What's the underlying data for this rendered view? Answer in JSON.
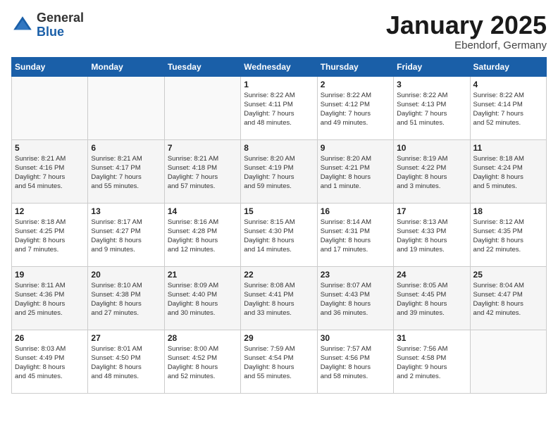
{
  "header": {
    "logo_general": "General",
    "logo_blue": "Blue",
    "month_title": "January 2025",
    "location": "Ebendorf, Germany"
  },
  "days_of_week": [
    "Sunday",
    "Monday",
    "Tuesday",
    "Wednesday",
    "Thursday",
    "Friday",
    "Saturday"
  ],
  "weeks": [
    [
      {
        "day": "",
        "info": ""
      },
      {
        "day": "",
        "info": ""
      },
      {
        "day": "",
        "info": ""
      },
      {
        "day": "1",
        "info": "Sunrise: 8:22 AM\nSunset: 4:11 PM\nDaylight: 7 hours\nand 48 minutes."
      },
      {
        "day": "2",
        "info": "Sunrise: 8:22 AM\nSunset: 4:12 PM\nDaylight: 7 hours\nand 49 minutes."
      },
      {
        "day": "3",
        "info": "Sunrise: 8:22 AM\nSunset: 4:13 PM\nDaylight: 7 hours\nand 51 minutes."
      },
      {
        "day": "4",
        "info": "Sunrise: 8:22 AM\nSunset: 4:14 PM\nDaylight: 7 hours\nand 52 minutes."
      }
    ],
    [
      {
        "day": "5",
        "info": "Sunrise: 8:21 AM\nSunset: 4:16 PM\nDaylight: 7 hours\nand 54 minutes."
      },
      {
        "day": "6",
        "info": "Sunrise: 8:21 AM\nSunset: 4:17 PM\nDaylight: 7 hours\nand 55 minutes."
      },
      {
        "day": "7",
        "info": "Sunrise: 8:21 AM\nSunset: 4:18 PM\nDaylight: 7 hours\nand 57 minutes."
      },
      {
        "day": "8",
        "info": "Sunrise: 8:20 AM\nSunset: 4:19 PM\nDaylight: 7 hours\nand 59 minutes."
      },
      {
        "day": "9",
        "info": "Sunrise: 8:20 AM\nSunset: 4:21 PM\nDaylight: 8 hours\nand 1 minute."
      },
      {
        "day": "10",
        "info": "Sunrise: 8:19 AM\nSunset: 4:22 PM\nDaylight: 8 hours\nand 3 minutes."
      },
      {
        "day": "11",
        "info": "Sunrise: 8:18 AM\nSunset: 4:24 PM\nDaylight: 8 hours\nand 5 minutes."
      }
    ],
    [
      {
        "day": "12",
        "info": "Sunrise: 8:18 AM\nSunset: 4:25 PM\nDaylight: 8 hours\nand 7 minutes."
      },
      {
        "day": "13",
        "info": "Sunrise: 8:17 AM\nSunset: 4:27 PM\nDaylight: 8 hours\nand 9 minutes."
      },
      {
        "day": "14",
        "info": "Sunrise: 8:16 AM\nSunset: 4:28 PM\nDaylight: 8 hours\nand 12 minutes."
      },
      {
        "day": "15",
        "info": "Sunrise: 8:15 AM\nSunset: 4:30 PM\nDaylight: 8 hours\nand 14 minutes."
      },
      {
        "day": "16",
        "info": "Sunrise: 8:14 AM\nSunset: 4:31 PM\nDaylight: 8 hours\nand 17 minutes."
      },
      {
        "day": "17",
        "info": "Sunrise: 8:13 AM\nSunset: 4:33 PM\nDaylight: 8 hours\nand 19 minutes."
      },
      {
        "day": "18",
        "info": "Sunrise: 8:12 AM\nSunset: 4:35 PM\nDaylight: 8 hours\nand 22 minutes."
      }
    ],
    [
      {
        "day": "19",
        "info": "Sunrise: 8:11 AM\nSunset: 4:36 PM\nDaylight: 8 hours\nand 25 minutes."
      },
      {
        "day": "20",
        "info": "Sunrise: 8:10 AM\nSunset: 4:38 PM\nDaylight: 8 hours\nand 27 minutes."
      },
      {
        "day": "21",
        "info": "Sunrise: 8:09 AM\nSunset: 4:40 PM\nDaylight: 8 hours\nand 30 minutes."
      },
      {
        "day": "22",
        "info": "Sunrise: 8:08 AM\nSunset: 4:41 PM\nDaylight: 8 hours\nand 33 minutes."
      },
      {
        "day": "23",
        "info": "Sunrise: 8:07 AM\nSunset: 4:43 PM\nDaylight: 8 hours\nand 36 minutes."
      },
      {
        "day": "24",
        "info": "Sunrise: 8:05 AM\nSunset: 4:45 PM\nDaylight: 8 hours\nand 39 minutes."
      },
      {
        "day": "25",
        "info": "Sunrise: 8:04 AM\nSunset: 4:47 PM\nDaylight: 8 hours\nand 42 minutes."
      }
    ],
    [
      {
        "day": "26",
        "info": "Sunrise: 8:03 AM\nSunset: 4:49 PM\nDaylight: 8 hours\nand 45 minutes."
      },
      {
        "day": "27",
        "info": "Sunrise: 8:01 AM\nSunset: 4:50 PM\nDaylight: 8 hours\nand 48 minutes."
      },
      {
        "day": "28",
        "info": "Sunrise: 8:00 AM\nSunset: 4:52 PM\nDaylight: 8 hours\nand 52 minutes."
      },
      {
        "day": "29",
        "info": "Sunrise: 7:59 AM\nSunset: 4:54 PM\nDaylight: 8 hours\nand 55 minutes."
      },
      {
        "day": "30",
        "info": "Sunrise: 7:57 AM\nSunset: 4:56 PM\nDaylight: 8 hours\nand 58 minutes."
      },
      {
        "day": "31",
        "info": "Sunrise: 7:56 AM\nSunset: 4:58 PM\nDaylight: 9 hours\nand 2 minutes."
      },
      {
        "day": "",
        "info": ""
      }
    ]
  ]
}
